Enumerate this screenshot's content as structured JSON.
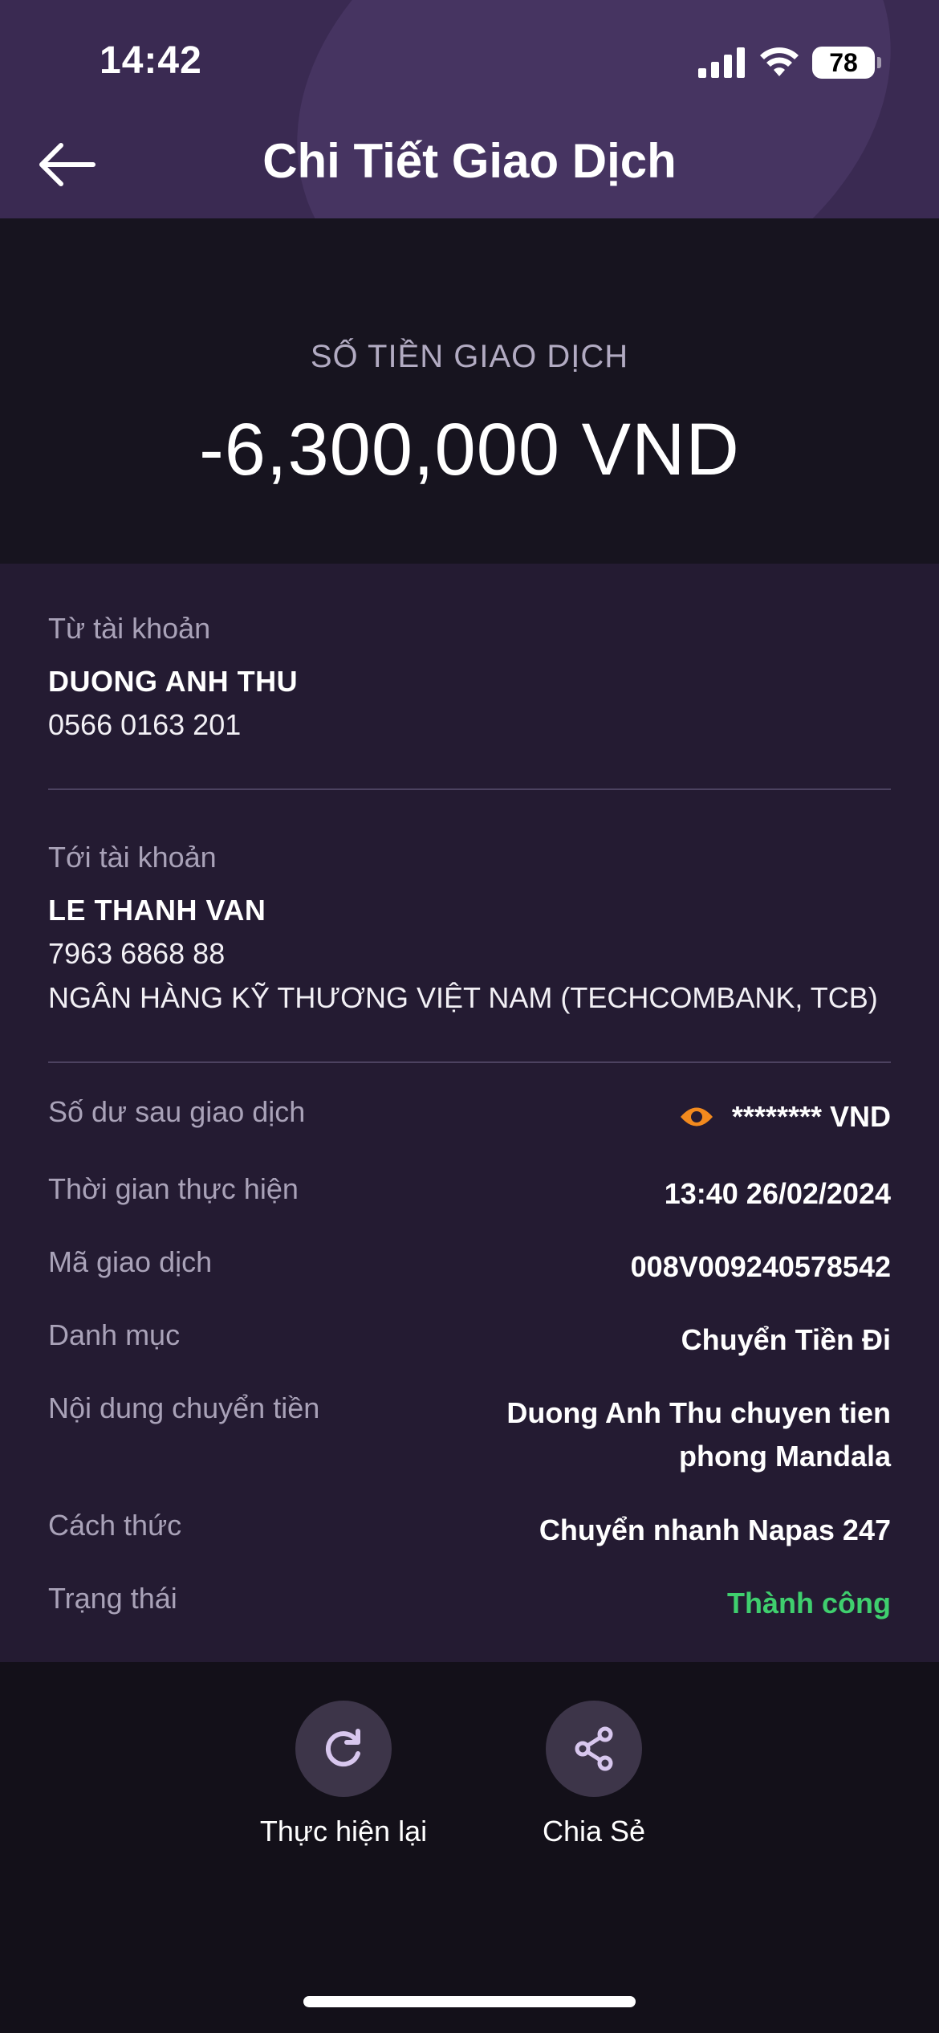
{
  "status_bar": {
    "time": "14:42",
    "battery": "78"
  },
  "header": {
    "title": "Chi Tiết Giao Dịch",
    "back_icon": "arrow-left-icon"
  },
  "amount": {
    "label": "SỐ TIỀN GIAO DỊCH",
    "value": "-6,300,000 VND"
  },
  "from_account": {
    "label": "Từ tài khoản",
    "name": "DUONG ANH THU",
    "number": "0566 0163 201"
  },
  "to_account": {
    "label": "Tới tài khoản",
    "name": "LE THANH VAN",
    "number": "7963 6868 88",
    "bank": "NGÂN HÀNG KỸ THƯƠNG VIỆT NAM (TECHCOMBANK, TCB)"
  },
  "details": {
    "balance_label": "Số dư sau giao dịch",
    "balance_value": "******** VND",
    "time_label": "Thời gian thực hiện",
    "time_value": "13:40 26/02/2024",
    "code_label": "Mã giao dịch",
    "code_value": "008V009240578542",
    "category_label": "Danh mục",
    "category_value": "Chuyển Tiền Đi",
    "content_label": "Nội dung chuyển tiền",
    "content_value_line1": "Duong Anh Thu chuyen tien",
    "content_value_line2": "phong Mandala",
    "method_label": "Cách thức",
    "method_value": "Chuyển nhanh Napas 247",
    "status_label": "Trạng thái",
    "status_value": "Thành công"
  },
  "actions": {
    "redo_label": "Thực hiện lại",
    "share_label": "Chia Sẻ"
  },
  "colors": {
    "header_bg": "#3a2a52",
    "details_bg": "#241b32",
    "success": "#3fcf6e",
    "eye_icon": "#f28a1e"
  }
}
